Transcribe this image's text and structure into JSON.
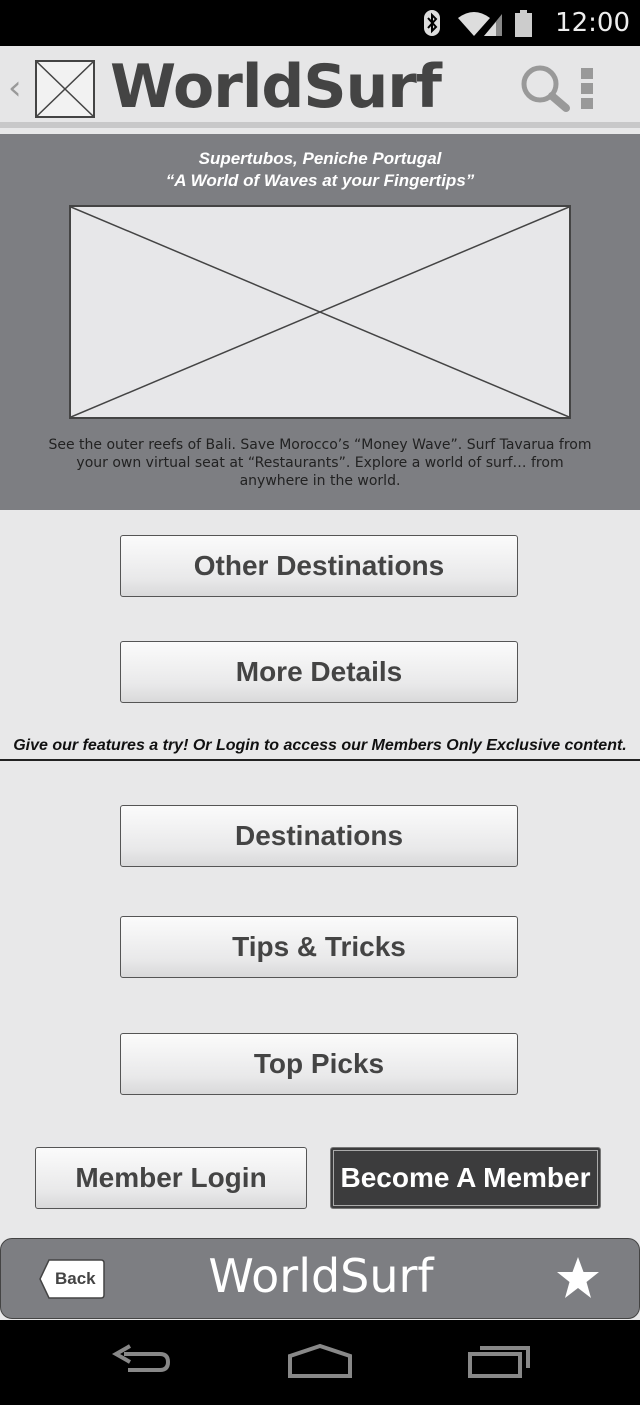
{
  "status_bar": {
    "time": "12:00",
    "icons": [
      "bluetooth-icon",
      "wifi-icon",
      "signal-icon",
      "battery-icon"
    ]
  },
  "action_bar": {
    "title": "WorldSurf",
    "icons": [
      "back-chevron-icon",
      "app-logo-icon",
      "search-icon",
      "overflow-menu-icon"
    ]
  },
  "hero": {
    "title_line1": "Supertubos, Peniche Portugal",
    "title_line2": "“A World of Waves at your Fingertips”",
    "description": "See the outer reefs of Bali. Save Morocco’s “Money Wave”. Surf Tavarua from your own virtual seat at “Restaurants”. Explore a world of surf… from anywhere in the world."
  },
  "buttons": {
    "other_destinations": "Other Destinations",
    "more_details": "More Details",
    "destinations": "Destinations",
    "tips_tricks": "Tips & Tricks",
    "top_picks": "Top Picks",
    "member_login": "Member Login",
    "become_member": "Become A Member"
  },
  "promo_text": "Give our features a try! Or Login to access our Members Only Exclusive content.",
  "footer": {
    "back_label": "Back",
    "title": "WorldSurf",
    "icons": [
      "star-icon"
    ]
  },
  "nav_bar": {
    "icons": [
      "nav-back-icon",
      "nav-home-icon",
      "nav-recents-icon"
    ]
  },
  "colors": {
    "hero_bg": "#7d7e82",
    "page_bg": "#e8e8e9",
    "dark_button": "#3c3c3d",
    "text": "#444444"
  }
}
